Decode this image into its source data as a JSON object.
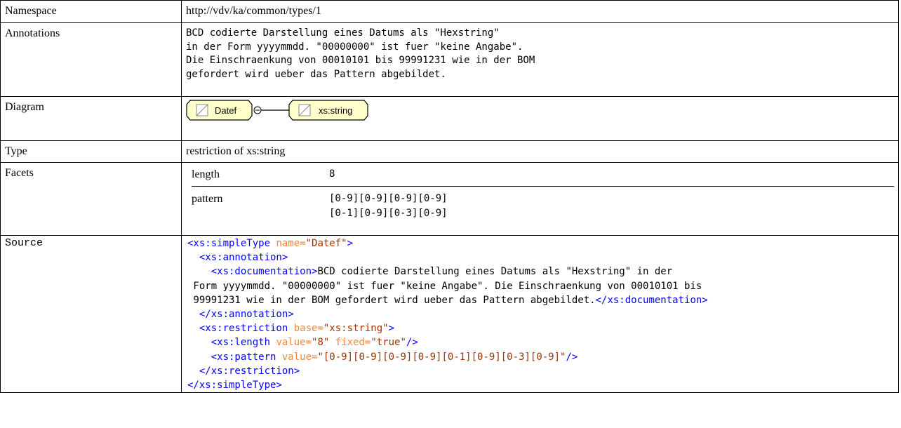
{
  "rows": {
    "namespace": {
      "label": "Namespace",
      "value": "http://vdv/ka/common/types/1"
    },
    "annotations": {
      "label": "Annotations",
      "lines": [
        "BCD codierte Darstellung eines Datums als \"Hexstring\"",
        "in der Form yyyymmdd. \"00000000\" ist fuer \"keine Angabe\".",
        "Die Einschraenkung von 00010101 bis 99991231 wie in der BOM",
        "gefordert wird ueber das Pattern abgebildet."
      ]
    },
    "diagram": {
      "label": "Diagram",
      "node1": "Datef",
      "node2": "xs:string",
      "stroke_color": "#000000",
      "fill_color": "#ffffcc"
    },
    "type": {
      "label": "Type",
      "value": "restriction of xs:string"
    },
    "facets": {
      "label": "Facets",
      "items": [
        {
          "name": "length",
          "value": "8"
        },
        {
          "name": "pattern",
          "value_lines": [
            "[0-9][0-9][0-9][0-9]",
            "[0-1][0-9][0-3][0-9]"
          ]
        }
      ]
    },
    "source": {
      "label": "Source",
      "colors": {
        "tag": "#0000ff",
        "attr": "#f2853c",
        "attr_value": "#993300"
      },
      "l1_open": "<xs:simpleType",
      "l1_attr": " name=",
      "l1_val": "\"Datef\"",
      "l1_close": ">",
      "l2": "  <xs:annotation>",
      "l3_tag": "    <xs:documentation>",
      "l3_text": "BCD codierte Darstellung eines Datums als \"Hexstring\" in der",
      "l4_text": " Form yyyymmdd. \"00000000\" ist fuer \"keine Angabe\". Die Einschraenkung von 00010101 bis",
      "l5_text": " 99991231 wie in der BOM gefordert wird ueber das Pattern abgebildet.",
      "l5_tag": "</xs:documentation>",
      "l6": "  </xs:annotation>",
      "l7_open": "  <xs:restriction",
      "l7_attr": " base=",
      "l7_val": "\"xs:string\"",
      "l7_close": ">",
      "l8_open": "    <xs:length",
      "l8_attr1": " value=",
      "l8_val1": "\"8\"",
      "l8_attr2": " fixed=",
      "l8_val2": "\"true\"",
      "l8_close": "/>",
      "l9_open": "    <xs:pattern",
      "l9_attr": " value=",
      "l9_val": "\"[0-9][0-9][0-9][0-9][0-1][0-9][0-3][0-9]\"",
      "l9_close": "/>",
      "l10": "  </xs:restriction>",
      "l11": "</xs:simpleType>"
    }
  }
}
